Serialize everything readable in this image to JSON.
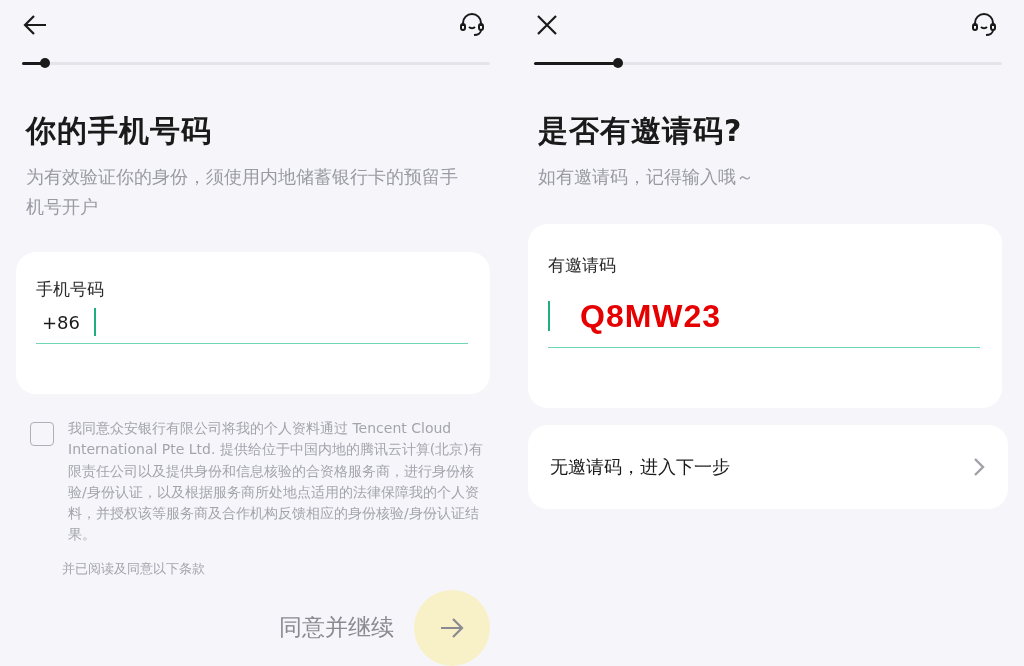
{
  "phone_screen": {
    "nav": {
      "kind": "back"
    },
    "progress": {
      "level": 0.05
    },
    "title": "你的手机号码",
    "subtitle": "为有效验证你的身份，须使用内地储蓄银行卡的预留手机号开户",
    "field": {
      "label": "手机号码",
      "prefix": "+86",
      "focused": true
    },
    "consent": {
      "checked": false,
      "text": "我同意众安银行有限公司将我的个人资料通过 Tencent Cloud International Pte Ltd. 提供给位于中国内地的腾讯云计算(北京)有限责任公司以及提供身份和信息核验的合资格服务商，进行身份核验/身份认证，以及根据服务商所处地点适用的法律保障我的个人资料，并授权该等服务商及合作机构反馈相应的身份核验/身份认证结果。",
      "note": "并已阅读及同意以下条款"
    },
    "continue": {
      "label": "同意并继续",
      "disabled": true
    }
  },
  "invite_screen": {
    "nav": {
      "kind": "close"
    },
    "progress": {
      "level": 0.18
    },
    "title": "是否有邀请码?",
    "subtitle": "如有邀请码，记得输入哦～",
    "field": {
      "label": "有邀请码",
      "value": "Q8MW23",
      "focused": true
    },
    "skip_option": {
      "label": "无邀请码，进入下一步"
    }
  }
}
